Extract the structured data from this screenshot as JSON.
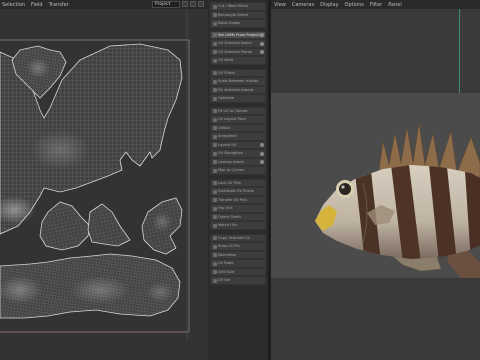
{
  "uv_editor": {
    "menu": [
      "Selection",
      "Field",
      "Transfer"
    ],
    "dropdown_value": "Project"
  },
  "tools": [
    {
      "label": "Cut / Weld Mirror",
      "active": false,
      "option": false
    },
    {
      "label": "Rectangle Select",
      "active": false,
      "option": false
    },
    {
      "label": "Relax Edges",
      "active": false,
      "option": false
    },
    {
      "label": "Set UVMs From Projection",
      "active": true,
      "option": true
    },
    {
      "label": "UV Selected Island",
      "active": false,
      "option": true
    },
    {
      "label": "UV Selected Points",
      "active": false,
      "option": true
    },
    {
      "label": "UV Weld",
      "active": false,
      "option": false
    },
    {
      "label": "UV Shells",
      "active": false,
      "option": false
    },
    {
      "label": "Scale Between Islands",
      "active": false,
      "option": false
    },
    {
      "label": "Fix Selected Islands",
      "active": false,
      "option": false
    },
    {
      "label": "Optimize",
      "active": false,
      "option": false
    },
    {
      "label": "Fit UV to Canvas",
      "active": false,
      "option": false
    },
    {
      "label": "UV Layout Pack",
      "active": false,
      "option": false
    },
    {
      "label": "Unfold",
      "active": false,
      "option": false
    },
    {
      "label": "Straighten",
      "active": false,
      "option": false
    },
    {
      "label": "Layout UV",
      "active": false,
      "option": true
    },
    {
      "label": "UV Straighten",
      "active": false,
      "option": true
    },
    {
      "label": "Unwrap Island",
      "active": false,
      "option": true
    },
    {
      "label": "Map to Curves",
      "active": false,
      "option": false
    },
    {
      "label": "Lock UV Pins",
      "active": false,
      "option": false
    },
    {
      "label": "Distribute UV Shells",
      "active": false,
      "option": false
    },
    {
      "label": "Transfer UV Pins",
      "active": false,
      "option": false
    },
    {
      "label": "Flip UVs",
      "active": false,
      "option": false
    },
    {
      "label": "Orient Shells",
      "active": false,
      "option": false
    },
    {
      "label": "Match UVs",
      "active": false,
      "option": false
    },
    {
      "label": "Copy Selected UV",
      "active": false,
      "option": false
    },
    {
      "label": "Snap UV Pin",
      "active": false,
      "option": false
    },
    {
      "label": "Normalize",
      "active": false,
      "option": false
    },
    {
      "label": "UV Ratio",
      "active": false,
      "option": false
    },
    {
      "label": "Grid Size",
      "active": false,
      "option": false
    },
    {
      "label": "UV Set",
      "active": false,
      "option": false
    }
  ],
  "viewport": {
    "menu": [
      "View",
      "Cameras",
      "Display",
      "Options",
      "Filter",
      "Panel"
    ]
  }
}
